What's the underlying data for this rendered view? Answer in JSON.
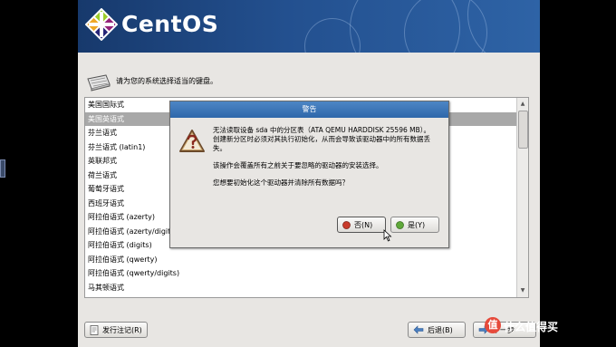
{
  "installer": {
    "brand": "CentOS",
    "prompt": "请为您的系统选择适当的键盘。",
    "keyboard_list": [
      {
        "label": "美国国际式",
        "selected": false
      },
      {
        "label": "美国英语式",
        "selected": true
      },
      {
        "label": "芬兰语式",
        "selected": false
      },
      {
        "label": "芬兰语式 (latin1)",
        "selected": false
      },
      {
        "label": "英联邦式",
        "selected": false
      },
      {
        "label": "荷兰语式",
        "selected": false
      },
      {
        "label": "葡萄牙语式",
        "selected": false
      },
      {
        "label": "西班牙语式",
        "selected": false
      },
      {
        "label": "阿拉伯语式 (azerty)",
        "selected": false
      },
      {
        "label": "阿拉伯语式 (azerty/digits)",
        "selected": false
      },
      {
        "label": "阿拉伯语式 (digits)",
        "selected": false
      },
      {
        "label": "阿拉伯语式 (qwerty)",
        "selected": false
      },
      {
        "label": "阿拉伯语式 (qwerty/digits)",
        "selected": false
      },
      {
        "label": "马其顿语式",
        "selected": false
      }
    ],
    "buttons": {
      "release_notes": "发行注记(R)",
      "back": "后退(B)",
      "next": "下一步"
    }
  },
  "dialog": {
    "title": "警告",
    "line1": "无法读取设备 sda 中的分区表（ATA QEMU HARDDISK 25596 MB）。",
    "line2": "创建新分区时必须对其执行初始化，从而会导致该驱动器中的所有数据丢失。",
    "line3": "该操作会覆盖所有之前关于要忽略的驱动器的安装选择。",
    "line4": "您想要初始化这个驱动器并清除所有数据吗？",
    "no_label": "否(N)",
    "yes_label": "是(Y)"
  },
  "watermark": {
    "badge": "值",
    "text": "什么值得买"
  },
  "colors": {
    "banner": "#23508f",
    "dialog_title": "#3a74b8",
    "selection": "#a8a8a8"
  }
}
